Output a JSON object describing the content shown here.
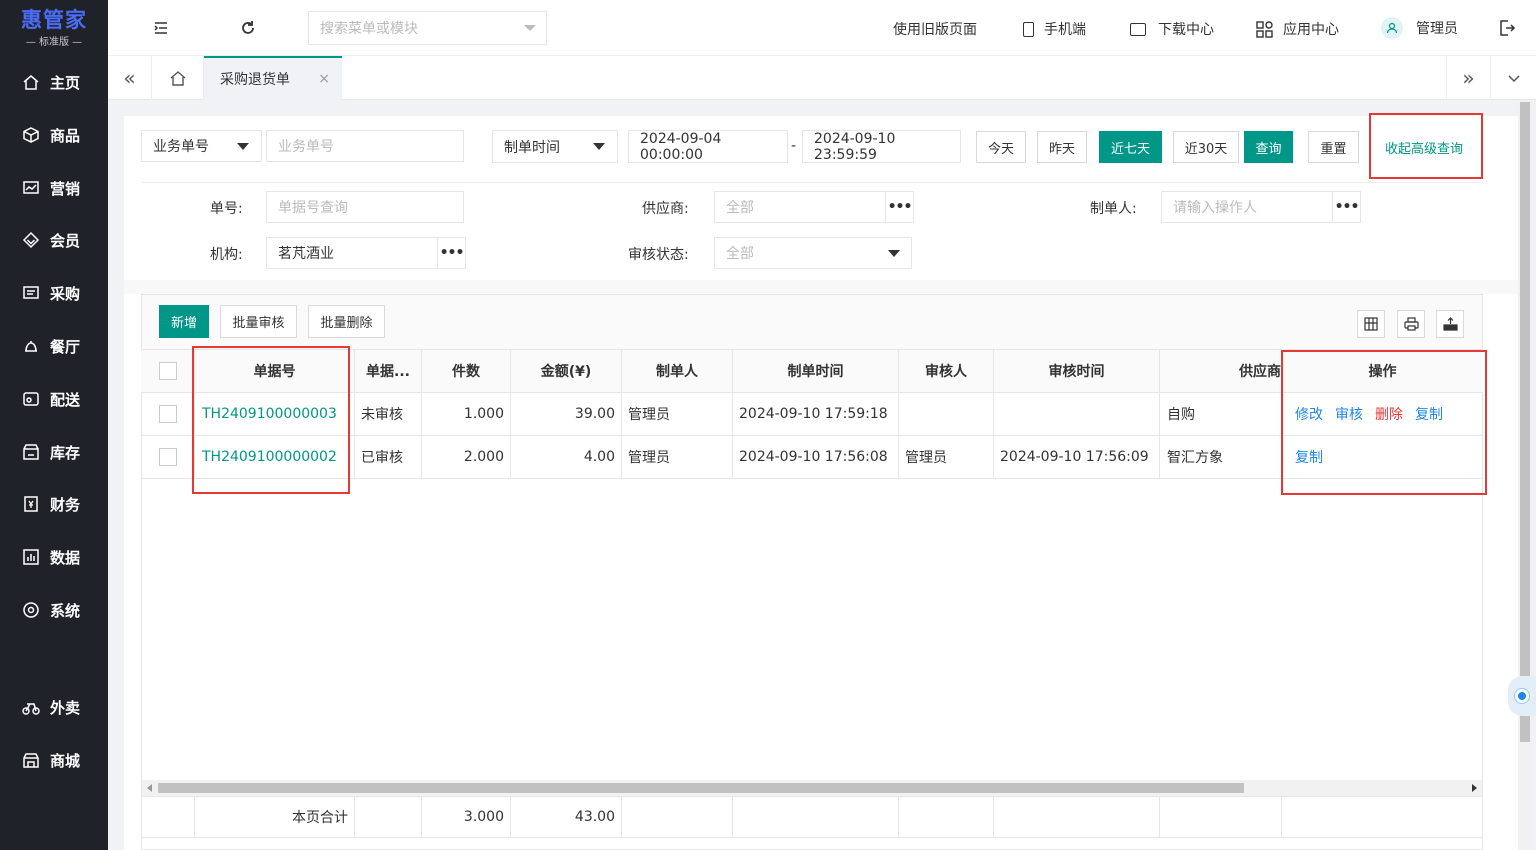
{
  "app": {
    "logo_title": "惠管家",
    "logo_subtitle": "— 标准版 —"
  },
  "sidebar": {
    "items": [
      {
        "label": "主页",
        "icon": "home-icon"
      },
      {
        "label": "商品",
        "icon": "box-icon"
      },
      {
        "label": "营销",
        "icon": "chart-icon"
      },
      {
        "label": "会员",
        "icon": "diamond-icon"
      },
      {
        "label": "采购",
        "icon": "cart-icon"
      },
      {
        "label": "餐厅",
        "icon": "bell-icon"
      },
      {
        "label": "配送",
        "icon": "delivery-icon"
      },
      {
        "label": "库存",
        "icon": "warehouse-icon"
      },
      {
        "label": "财务",
        "icon": "finance-icon"
      },
      {
        "label": "数据",
        "icon": "data-icon"
      },
      {
        "label": "系统",
        "icon": "settings-icon"
      },
      {
        "label": "外卖",
        "icon": "bike-icon"
      },
      {
        "label": "商城",
        "icon": "store-icon"
      }
    ]
  },
  "topbar": {
    "search_placeholder": "搜索菜单或模块",
    "old_version": "使用旧版页面",
    "mobile": "手机端",
    "download": "下载中心",
    "apps": "应用中心",
    "user": "管理员"
  },
  "tabs": {
    "active": "采购退货单",
    "close": "×"
  },
  "filters": {
    "field_select": "业务单号",
    "field_placeholder": "业务单号",
    "time_select": "制单时间",
    "start": "2024-09-04 00:00:00",
    "sep": "-",
    "end": "2024-09-10 23:59:59",
    "today": "今天",
    "yesterday": "昨天",
    "last7": "近七天",
    "last30": "近30天",
    "query": "查询",
    "reset": "重置",
    "collapse": "收起高级查询",
    "no_label": "单号:",
    "no_placeholder": "单据号查询",
    "supplier_label": "供应商:",
    "supplier_value": "全部",
    "creator_label": "制单人:",
    "creator_placeholder": "请输入操作人",
    "org_label": "机构:",
    "org_value": "茗芃酒业",
    "status_label": "审核状态:",
    "status_value": "全部"
  },
  "toolbar": {
    "add": "新增",
    "batch_audit": "批量审核",
    "batch_delete": "批量删除"
  },
  "table": {
    "headers": [
      "单据号",
      "单据...",
      "件数",
      "金额(¥)",
      "制单人",
      "制单时间",
      "审核人",
      "审核时间",
      "供应商",
      "操作"
    ],
    "rows": [
      {
        "no": "TH2409100000003",
        "status": "未审核",
        "qty": "1.000",
        "amount": "39.00",
        "creator": "管理员",
        "created": "2024-09-10 17:59:18",
        "auditor": "",
        "audited": "",
        "supplier": "自购",
        "ops": [
          "修改",
          "审核",
          "删除",
          "复制"
        ]
      },
      {
        "no": "TH2409100000002",
        "status": "已审核",
        "qty": "2.000",
        "amount": "4.00",
        "creator": "管理员",
        "created": "2024-09-10 17:56:08",
        "auditor": "管理员",
        "audited": "2024-09-10 17:56:09",
        "supplier": "智汇方象",
        "ops": [
          "复制"
        ]
      }
    ],
    "footer": {
      "label": "本页合计",
      "qty": "3.000",
      "amount": "43.00"
    }
  },
  "colors": {
    "primary": "#009688",
    "sidebar": "#20222a",
    "highlight": "#e53935",
    "link_blue": "#1e88e5"
  }
}
